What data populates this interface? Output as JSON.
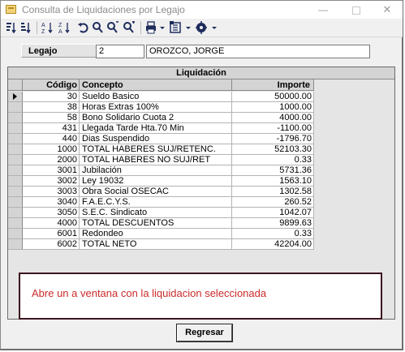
{
  "window": {
    "title": "Consulta de Liquidaciones por Legajo",
    "minimize": "—",
    "close": "✕"
  },
  "toolbar": {
    "icons": [
      "sort-asc-icon",
      "sort-desc-icon",
      "sort-az-icon",
      "sort-za-icon",
      "undo-icon",
      "search-icon",
      "find-next-icon",
      "find-prev-icon",
      "print-icon",
      "export-icon",
      "config-icon"
    ]
  },
  "legajo": {
    "label": "Legajo",
    "number": "2",
    "name": "OROZCO, JORGE"
  },
  "grid": {
    "caption": "Liquidación",
    "columns": {
      "codigo": "Código",
      "concepto": "Concepto",
      "importe": "Importe"
    },
    "rows": [
      {
        "codigo": "30",
        "concepto": "Sueldo Basico",
        "importe": "50000.00"
      },
      {
        "codigo": "38",
        "concepto": "Horas Extras 100%",
        "importe": "1000.00"
      },
      {
        "codigo": "58",
        "concepto": "Bono Solidario Cuota 2",
        "importe": "4000.00"
      },
      {
        "codigo": "431",
        "concepto": "Llegada Tarde Hta.70 Min",
        "importe": "-1100.00"
      },
      {
        "codigo": "440",
        "concepto": "Dias Suspendido",
        "importe": "-1796.70"
      },
      {
        "codigo": "1000",
        "concepto": "TOTAL HABERES SUJ/RETENC.",
        "importe": "52103.30"
      },
      {
        "codigo": "2000",
        "concepto": "TOTAL HABERES NO SUJ/RET",
        "importe": "0.33"
      },
      {
        "codigo": "3001",
        "concepto": "Jubilación",
        "importe": "5731.36"
      },
      {
        "codigo": "3002",
        "concepto": "Ley 19032",
        "importe": "1563.10"
      },
      {
        "codigo": "3003",
        "concepto": "Obra Social OSECAC",
        "importe": "1302.58"
      },
      {
        "codigo": "3040",
        "concepto": "F.A.E.C.Y.S.",
        "importe": "260.52"
      },
      {
        "codigo": "3050",
        "concepto": "S.E.C. Sindicato",
        "importe": "1042.07"
      },
      {
        "codigo": "4000",
        "concepto": "TOTAL DESCUENTOS",
        "importe": "9899.63"
      },
      {
        "codigo": "6001",
        "concepto": "Redondeo",
        "importe": "0.33"
      },
      {
        "codigo": "6002",
        "concepto": "TOTAL NETO",
        "importe": "42204.00"
      }
    ]
  },
  "annotation": {
    "text": "Abre un a ventana con la liquidacion seleccionada"
  },
  "buttons": {
    "regresar": "Regresar"
  },
  "colors": {
    "annotation_text": "#cc2a2a",
    "annotation_border": "#3c1620",
    "toolbar_icon": "#1e2c5c"
  }
}
